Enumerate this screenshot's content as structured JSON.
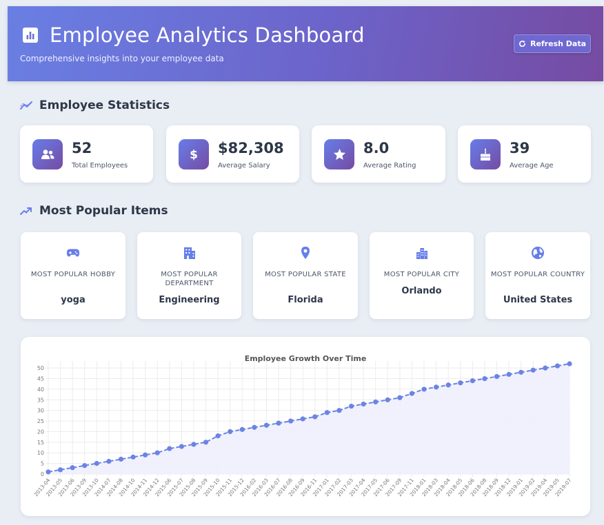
{
  "header": {
    "title": "Employee Analytics Dashboard",
    "subtitle": "Comprehensive insights into your employee data",
    "refresh_label": "Refresh Data"
  },
  "sections": {
    "stats_title": "Employee Statistics",
    "popular_title": "Most Popular Items"
  },
  "stats": [
    {
      "value": "52",
      "label": "Total Employees",
      "icon": "users-icon"
    },
    {
      "value": "$82,308",
      "label": "Average Salary",
      "icon": "dollar-icon"
    },
    {
      "value": "8.0",
      "label": "Average Rating",
      "icon": "star-icon"
    },
    {
      "value": "39",
      "label": "Average Age",
      "icon": "birthday-cake-icon"
    }
  ],
  "popular": [
    {
      "label": "Most Popular Hobby",
      "value": "yoga",
      "icon": "gamepad-icon"
    },
    {
      "label": "Most Popular Department",
      "value": "Engineering",
      "icon": "building-icon"
    },
    {
      "label": "Most Popular State",
      "value": "Florida",
      "icon": "map-marker-icon"
    },
    {
      "label": "Most Popular City",
      "value": "Orlando",
      "icon": "city-icon"
    },
    {
      "label": "Most Popular Country",
      "value": "United States",
      "icon": "globe-icon"
    }
  ],
  "colors": {
    "accent": "#667eea",
    "accent_secondary": "#764ba2",
    "line": "#6b84e3",
    "fill": "#eef0fc"
  },
  "chart_data": {
    "type": "line",
    "title": "Employee Growth Over Time",
    "xlabel": "",
    "ylabel": "",
    "ylim": [
      0,
      52
    ],
    "yticks": [
      0,
      5,
      10,
      15,
      20,
      25,
      30,
      35,
      40,
      45,
      50
    ],
    "grid": true,
    "legend": "none",
    "categories": [
      "2013-04",
      "2013-05",
      "2013-06",
      "2013-09",
      "2013-10",
      "2014-07",
      "2014-08",
      "2014-10",
      "2014-11",
      "2014-12",
      "2015-06",
      "2015-07",
      "2015-08",
      "2015-09",
      "2015-10",
      "2015-11",
      "2015-12",
      "2016-02",
      "2016-03",
      "2016-07",
      "2016-08",
      "2016-09",
      "2016-11",
      "2017-01",
      "2017-02",
      "2017-03",
      "2017-04",
      "2017-05",
      "2017-06",
      "2017-09",
      "2017-11",
      "2018-01",
      "2018-03",
      "2018-04",
      "2018-05",
      "2018-06",
      "2018-08",
      "2018-09",
      "2018-12",
      "2019-01",
      "2019-02",
      "2019-04",
      "2019-05",
      "2019-07"
    ],
    "series": [
      {
        "values": [
          1,
          2,
          3,
          4,
          5,
          6,
          7,
          8,
          9,
          10,
          12,
          13,
          14,
          15,
          18,
          20,
          21,
          22,
          23,
          24,
          25,
          26,
          27,
          29,
          30,
          32,
          33,
          34,
          35,
          36,
          38,
          40,
          41,
          42,
          43,
          44,
          45,
          46,
          47,
          48,
          49,
          50,
          51,
          52
        ]
      }
    ]
  }
}
